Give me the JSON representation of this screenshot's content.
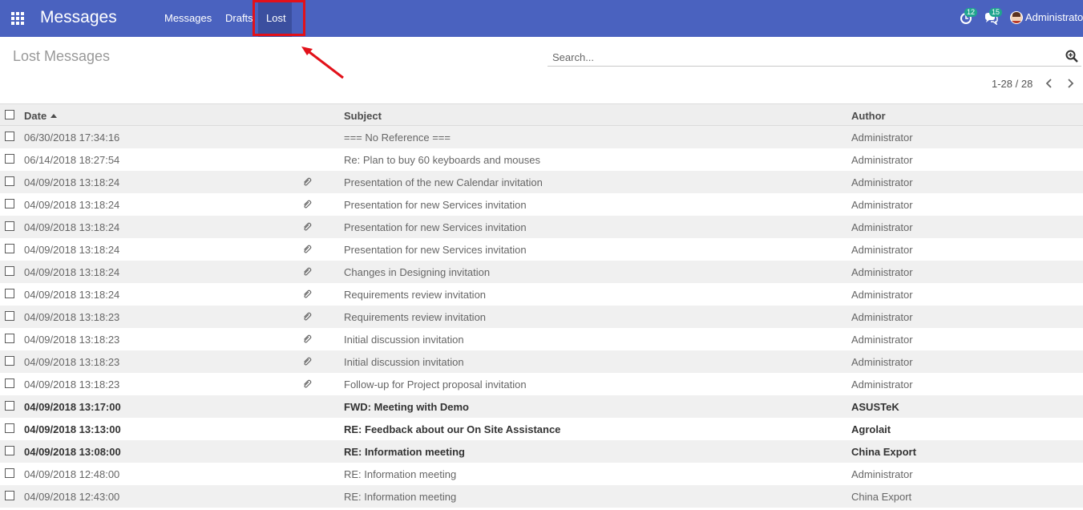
{
  "navbar": {
    "app_title": "Messages",
    "menu": [
      "Messages",
      "Drafts",
      "Lost"
    ],
    "active_menu": "Lost",
    "activity_count": "12",
    "chat_count": "15",
    "user_name": "Administrator"
  },
  "control_panel": {
    "title": "Lost Messages",
    "search_placeholder": "Search...",
    "pager": "1-28 / 28"
  },
  "table": {
    "columns": [
      "Date",
      "Subject",
      "Author"
    ],
    "rows": [
      {
        "date": "06/30/2018 17:34:16",
        "subject": "=== No Reference ===",
        "author": "Administrator",
        "attachment": false,
        "unread": false
      },
      {
        "date": "06/14/2018 18:27:54",
        "subject": "Re: Plan to buy 60 keyboards and mouses",
        "author": "Administrator",
        "attachment": false,
        "unread": false
      },
      {
        "date": "04/09/2018 13:18:24",
        "subject": "Presentation of the new Calendar invitation",
        "author": "Administrator",
        "attachment": true,
        "unread": false
      },
      {
        "date": "04/09/2018 13:18:24",
        "subject": "Presentation for new Services invitation",
        "author": "Administrator",
        "attachment": true,
        "unread": false
      },
      {
        "date": "04/09/2018 13:18:24",
        "subject": "Presentation for new Services invitation",
        "author": "Administrator",
        "attachment": true,
        "unread": false
      },
      {
        "date": "04/09/2018 13:18:24",
        "subject": "Presentation for new Services invitation",
        "author": "Administrator",
        "attachment": true,
        "unread": false
      },
      {
        "date": "04/09/2018 13:18:24",
        "subject": "Changes in Designing invitation",
        "author": "Administrator",
        "attachment": true,
        "unread": false
      },
      {
        "date": "04/09/2018 13:18:24",
        "subject": "Requirements review invitation",
        "author": "Administrator",
        "attachment": true,
        "unread": false
      },
      {
        "date": "04/09/2018 13:18:23",
        "subject": "Requirements review invitation",
        "author": "Administrator",
        "attachment": true,
        "unread": false
      },
      {
        "date": "04/09/2018 13:18:23",
        "subject": "Initial discussion invitation",
        "author": "Administrator",
        "attachment": true,
        "unread": false
      },
      {
        "date": "04/09/2018 13:18:23",
        "subject": "Initial discussion invitation",
        "author": "Administrator",
        "attachment": true,
        "unread": false
      },
      {
        "date": "04/09/2018 13:18:23",
        "subject": "Follow-up for Project proposal invitation",
        "author": "Administrator",
        "attachment": true,
        "unread": false
      },
      {
        "date": "04/09/2018 13:17:00",
        "subject": "FWD: Meeting with Demo",
        "author": "ASUSTeK",
        "attachment": false,
        "unread": true
      },
      {
        "date": "04/09/2018 13:13:00",
        "subject": "RE: Feedback about our On Site Assistance",
        "author": "Agrolait",
        "attachment": false,
        "unread": true
      },
      {
        "date": "04/09/2018 13:08:00",
        "subject": "RE: Information meeting",
        "author": "China Export",
        "attachment": false,
        "unread": true
      },
      {
        "date": "04/09/2018 12:48:00",
        "subject": "RE: Information meeting",
        "author": "Administrator",
        "attachment": false,
        "unread": false
      },
      {
        "date": "04/09/2018 12:43:00",
        "subject": "RE: Information meeting",
        "author": "China Export",
        "attachment": false,
        "unread": false
      }
    ]
  },
  "colors": {
    "navbar": "#4a62bf",
    "highlight": "#e2111a",
    "badge": "#1fa58e"
  }
}
